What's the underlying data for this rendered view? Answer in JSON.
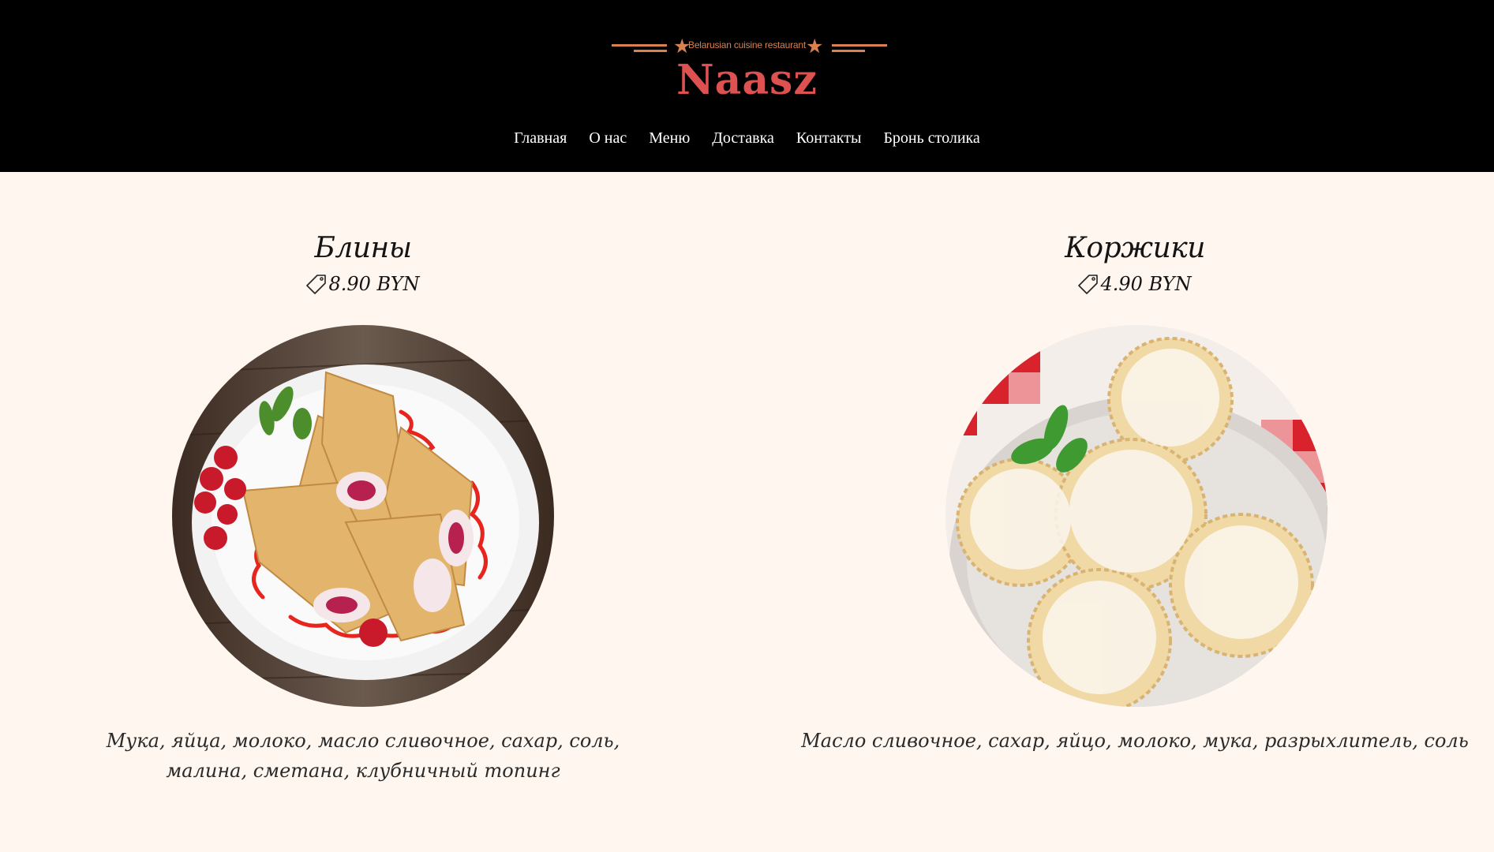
{
  "header": {
    "tagline": "Belarusian cuisine restaurant",
    "logo": "Naasz",
    "colors": {
      "background": "#000000",
      "accent": "#d9824f",
      "logo": "#dd5151"
    }
  },
  "nav": {
    "items": [
      {
        "label": "Главная"
      },
      {
        "label": "О нас"
      },
      {
        "label": "Меню"
      },
      {
        "label": "Доставка"
      },
      {
        "label": "Контакты"
      },
      {
        "label": "Бронь столика"
      }
    ]
  },
  "menu": {
    "items": [
      {
        "title": "Блины",
        "price": "8.90 BYN",
        "price_icon": "tag-icon",
        "image": "pancakes-photo",
        "ingredients": "Мука, яйца, молоко, масло сливочное, сахар, соль, малина, сметана, клубничный топинг"
      },
      {
        "title": "Коржики",
        "price": "4.90 BYN",
        "price_icon": "tag-icon",
        "image": "shortbread-cookies-photo",
        "ingredients": "Масло сливочное, сахар, яйцо, молоко, мука, разрыхлитель, соль"
      }
    ]
  },
  "page": {
    "background": "#fff6ef"
  }
}
